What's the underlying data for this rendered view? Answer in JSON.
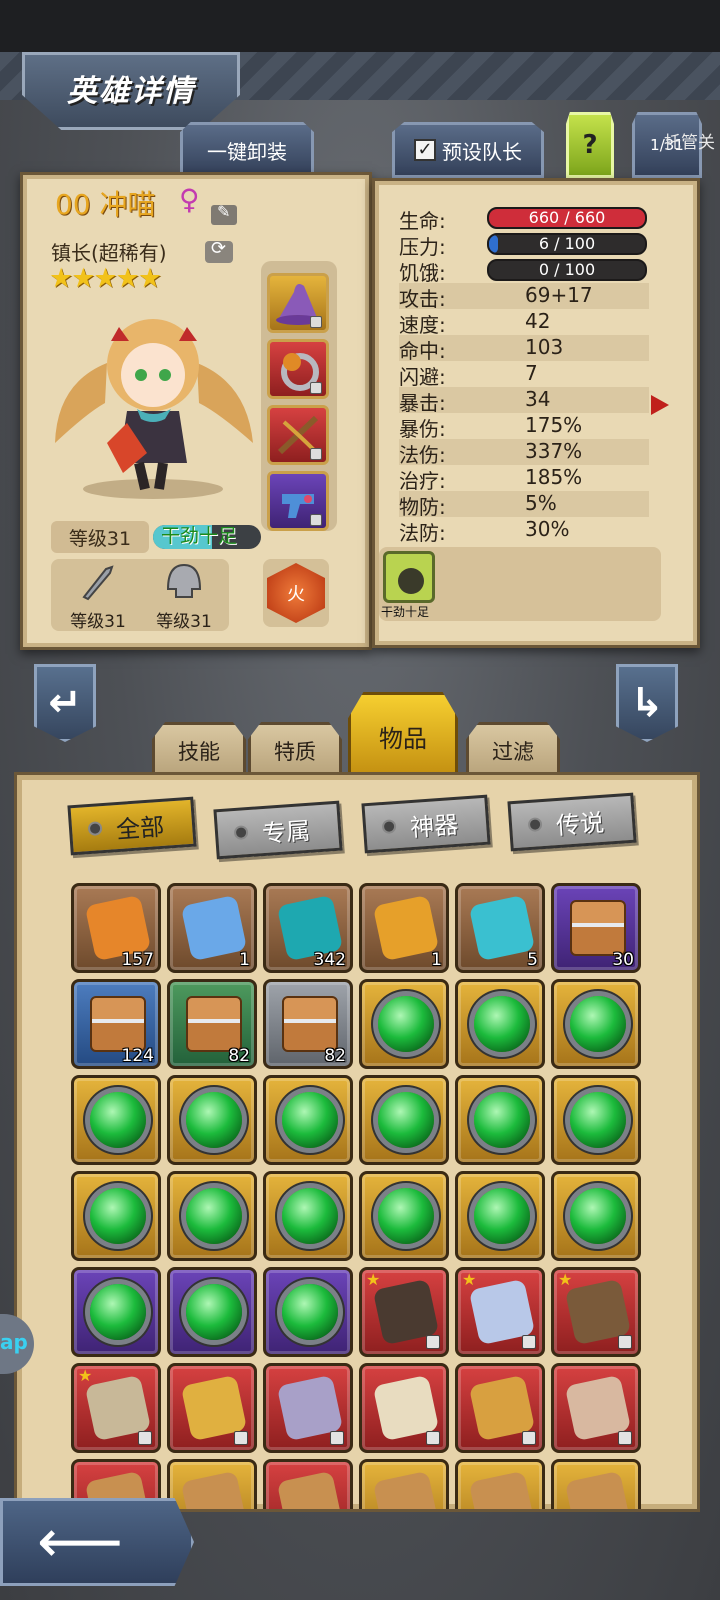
{
  "header": {
    "title": "英雄详情"
  },
  "toolbar": {
    "unequip_all": "一键卸装",
    "preset_leader": "预设队长",
    "help": "?",
    "counter": "1/31",
    "auto": "托管关"
  },
  "hero": {
    "name": "00 冲喵",
    "gender": "♀",
    "title": "镇长(超稀有)",
    "stars": "★★★★★",
    "level": "等级31",
    "mood": "干劲十足",
    "mood_level": 0.55,
    "weapon_level": "等级31",
    "armor_level": "等级31",
    "element": "火"
  },
  "stats": {
    "bars": [
      {
        "label": "生命:",
        "value": "660 / 660",
        "fill": 1.0,
        "color": "#cf2d3a"
      },
      {
        "label": "压力:",
        "value": "6 / 100",
        "fill": 0.06,
        "color": "#2f6fd0"
      },
      {
        "label": "饥饿:",
        "value": "0 / 100",
        "fill": 0.0,
        "color": "#6a6a6a"
      }
    ],
    "rows": [
      {
        "label": "攻击:",
        "value": "69+17"
      },
      {
        "label": "速度:",
        "value": "42"
      },
      {
        "label": "命中:",
        "value": "103"
      },
      {
        "label": "闪避:",
        "value": "7"
      },
      {
        "label": "暴击:",
        "value": "34"
      },
      {
        "label": "暴伤:",
        "value": "175%"
      },
      {
        "label": "法伤:",
        "value": "337%"
      },
      {
        "label": "治疗:",
        "value": "185%"
      },
      {
        "label": "物防:",
        "value": "5%"
      },
      {
        "label": "法防:",
        "value": "30%"
      }
    ],
    "trait": "干劲十足"
  },
  "tabs": [
    "技能",
    "特质",
    "物品",
    "过滤"
  ],
  "active_tab": "物品",
  "filters": [
    "全部",
    "专属",
    "神器",
    "传说"
  ],
  "items": {
    "counts": [
      "157",
      "1",
      "342",
      "1",
      "5",
      "30",
      "124",
      "82",
      "82"
    ]
  },
  "colors": {
    "accent": "#e7a620",
    "panel": "#e9d9b4"
  }
}
